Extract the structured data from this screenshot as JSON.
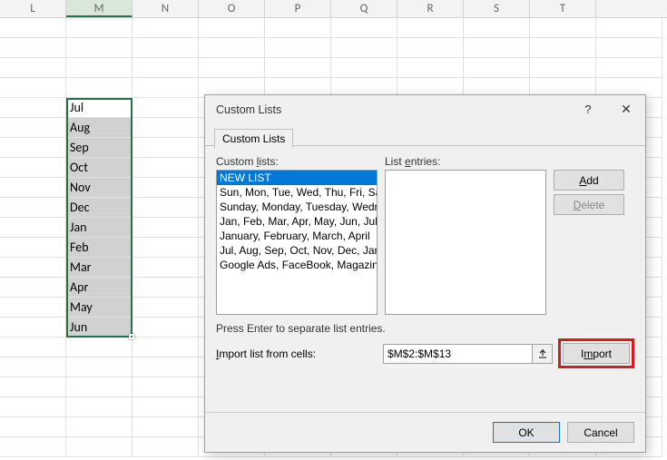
{
  "columns": [
    "L",
    "M",
    "N",
    "O",
    "P",
    "Q",
    "R",
    "S",
    "T"
  ],
  "active_column_index": 1,
  "month_cells": [
    "Jul",
    "Aug",
    "Sep",
    "Oct",
    "Nov",
    "Dec",
    "Jan",
    "Feb",
    "Mar",
    "Apr",
    "May",
    "Jun"
  ],
  "dialog": {
    "title": "Custom Lists",
    "help_label": "?",
    "close_label": "✕",
    "tab": "Custom Lists",
    "custom_lists_label": "Custom lists:",
    "list_entries_label": "List entries:",
    "lists": [
      "NEW LIST",
      "Sun, Mon, Tue, Wed, Thu, Fri, Sat",
      "Sunday, Monday, Tuesday, Wednesday",
      "Jan, Feb, Mar, Apr, May, Jun, Jul",
      "January, February, March, April",
      "Jul, Aug, Sep, Oct, Nov, Dec, Jan",
      "Google Ads, FaceBook, Magazines"
    ],
    "selected_list_index": 0,
    "add_label": "Add",
    "delete_label": "Delete",
    "hint": "Press Enter to separate list entries.",
    "import_label": "Import list from cells:",
    "ref_value": "$M$2:$M$13",
    "import_btn": "Import",
    "ok": "OK",
    "cancel": "Cancel"
  }
}
